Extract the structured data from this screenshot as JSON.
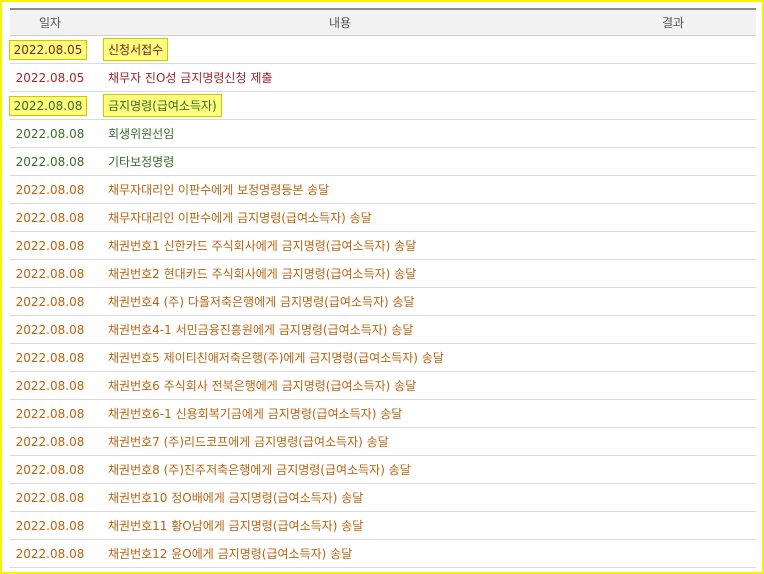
{
  "header": {
    "date": "일자",
    "content": "내용",
    "result": "결과"
  },
  "colors": {
    "red": "#a0252e",
    "green": "#3a6a2a",
    "orange": "#b86412",
    "highlight": "#fefe7e",
    "frame": "#f7f300"
  },
  "rows": [
    {
      "date": "2022.08.05",
      "content": "신청서접수",
      "result": "",
      "color": "#7a1d1d",
      "highlight": true
    },
    {
      "date": "2022.08.05",
      "content": "채무자 진O성 금지명령신청 제출",
      "result": "",
      "color": "#a0252e",
      "highlight": false
    },
    {
      "date": "2022.08.08",
      "content": "금지명령(급여소득자)",
      "result": "",
      "color": "#3a6a2a",
      "highlight": true
    },
    {
      "date": "2022.08.08",
      "content": "회생위원선임",
      "result": "",
      "color": "#3a6a2a",
      "highlight": false
    },
    {
      "date": "2022.08.08",
      "content": "기타보정명령",
      "result": "",
      "color": "#3a6a2a",
      "highlight": false
    },
    {
      "date": "2022.08.08",
      "content": "채무자대리인 이판수에게 보정명령등본 송달",
      "result": "",
      "color": "#b86412",
      "highlight": false
    },
    {
      "date": "2022.08.08",
      "content": "채무자대리인 이판수에게 금지명령(급여소득자) 송달",
      "result": "",
      "color": "#b86412",
      "highlight": false
    },
    {
      "date": "2022.08.08",
      "content": "채권번호1 신한카드 주식회사에게 금지명령(급여소득자) 송달",
      "result": "",
      "color": "#b86412",
      "highlight": false
    },
    {
      "date": "2022.08.08",
      "content": "채권번호2 현대카드 주식회사에게 금지명령(급여소득자) 송달",
      "result": "",
      "color": "#b86412",
      "highlight": false
    },
    {
      "date": "2022.08.08",
      "content": "채권번호4 (주) 다올저축은행에게 금지명령(급여소득자) 송달",
      "result": "",
      "color": "#b86412",
      "highlight": false
    },
    {
      "date": "2022.08.08",
      "content": "채권번호4-1 서민금융진흥원에게 금지명령(급여소득자) 송달",
      "result": "",
      "color": "#b86412",
      "highlight": false
    },
    {
      "date": "2022.08.08",
      "content": "채권번호5 제이티친애저축은행(주)에게 금지명령(급여소득자) 송달",
      "result": "",
      "color": "#b86412",
      "highlight": false
    },
    {
      "date": "2022.08.08",
      "content": "채권번호6 주식회사 전북은행에게 금지명령(급여소득자) 송달",
      "result": "",
      "color": "#b86412",
      "highlight": false
    },
    {
      "date": "2022.08.08",
      "content": "채권번호6-1 신용회복기금에게 금지명령(급여소득자) 송달",
      "result": "",
      "color": "#b86412",
      "highlight": false
    },
    {
      "date": "2022.08.08",
      "content": "채권번호7 (주)리드코프에게 금지명령(급여소득자) 송달",
      "result": "",
      "color": "#b86412",
      "highlight": false
    },
    {
      "date": "2022.08.08",
      "content": "채권번호8 (주)진주저축은행에게 금지명령(급여소득자) 송달",
      "result": "",
      "color": "#b86412",
      "highlight": false
    },
    {
      "date": "2022.08.08",
      "content": "채권번호10 정O배에게 금지명령(급여소득자) 송달",
      "result": "",
      "color": "#b86412",
      "highlight": false
    },
    {
      "date": "2022.08.08",
      "content": "채권번호11 황O남에게 금지명령(급여소득자) 송달",
      "result": "",
      "color": "#b86412",
      "highlight": false
    },
    {
      "date": "2022.08.08",
      "content": "채권번호12 윤O에게 금지명령(급여소득자) 송달",
      "result": "",
      "color": "#b86412",
      "highlight": false
    }
  ]
}
